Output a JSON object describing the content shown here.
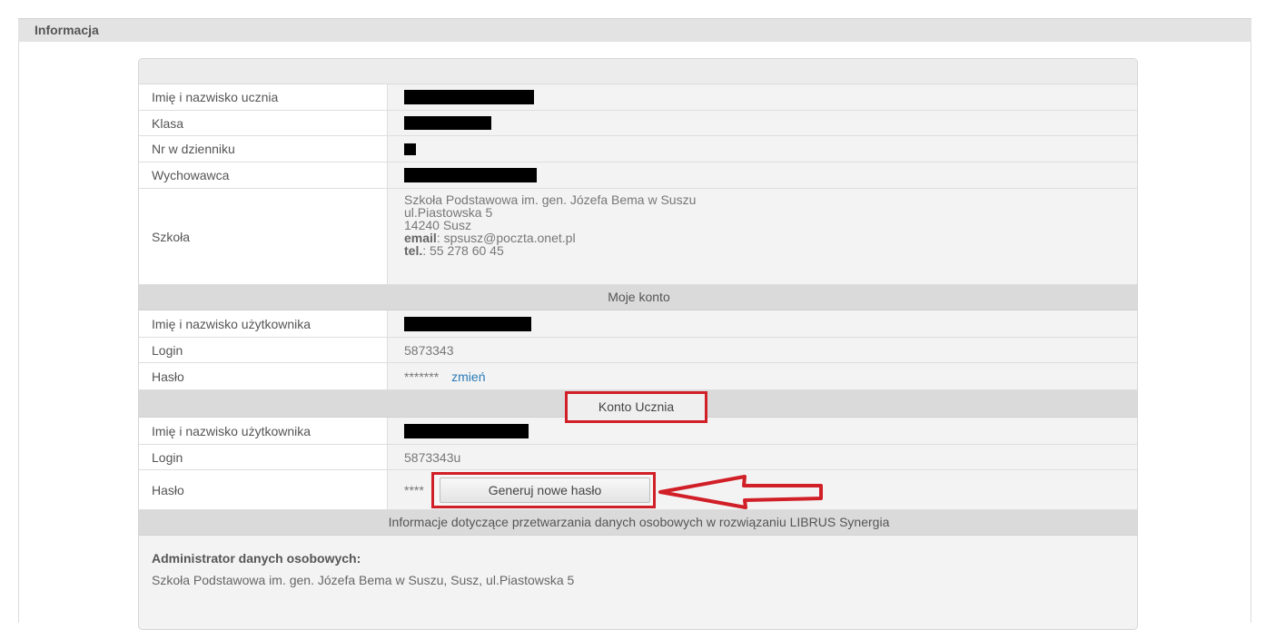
{
  "header": {
    "title": "Informacja"
  },
  "student": {
    "name_label": "Imię i nazwisko ucznia",
    "class_label": "Klasa",
    "number_label": "Nr w dzienniku",
    "teacher_label": "Wychowawca",
    "school_label": "Szkoła",
    "school_name": "Szkoła Podstawowa im. gen. Józefa Bema w Suszu",
    "school_street": "ul.Piastowska 5",
    "school_city": "14240 Susz",
    "email_label": "email",
    "email_value": ": spsusz@poczta.onet.pl",
    "tel_label": "tel.",
    "tel_value": ": 55 278 60 45"
  },
  "my_account": {
    "section_title": "Moje konto",
    "name_label": "Imię i nazwisko użytkownika",
    "login_label": "Login",
    "login_value": "5873343",
    "password_label": "Hasło",
    "password_value": "*******",
    "change_link": "zmień"
  },
  "student_account": {
    "section_title": "Konto Ucznia",
    "name_label": "Imię i nazwisko użytkownika",
    "login_label": "Login",
    "login_value": "5873343u",
    "password_label": "Hasło",
    "password_value": "****",
    "generate_button": "Generuj nowe hasło"
  },
  "data_processing": {
    "section_title": "Informacje dotyczące przetwarzania danych osobowych w rozwiązaniu LIBRUS Synergia",
    "admin_title": "Administrator danych osobowych:",
    "admin_text": "Szkoła Podstawowa im. gen. Józefa Bema w Suszu, Susz, ul.Piastowska 5"
  },
  "colors": {
    "highlight": "#d11f28",
    "link": "#2a7ab8",
    "section_bg": "#dadada"
  }
}
